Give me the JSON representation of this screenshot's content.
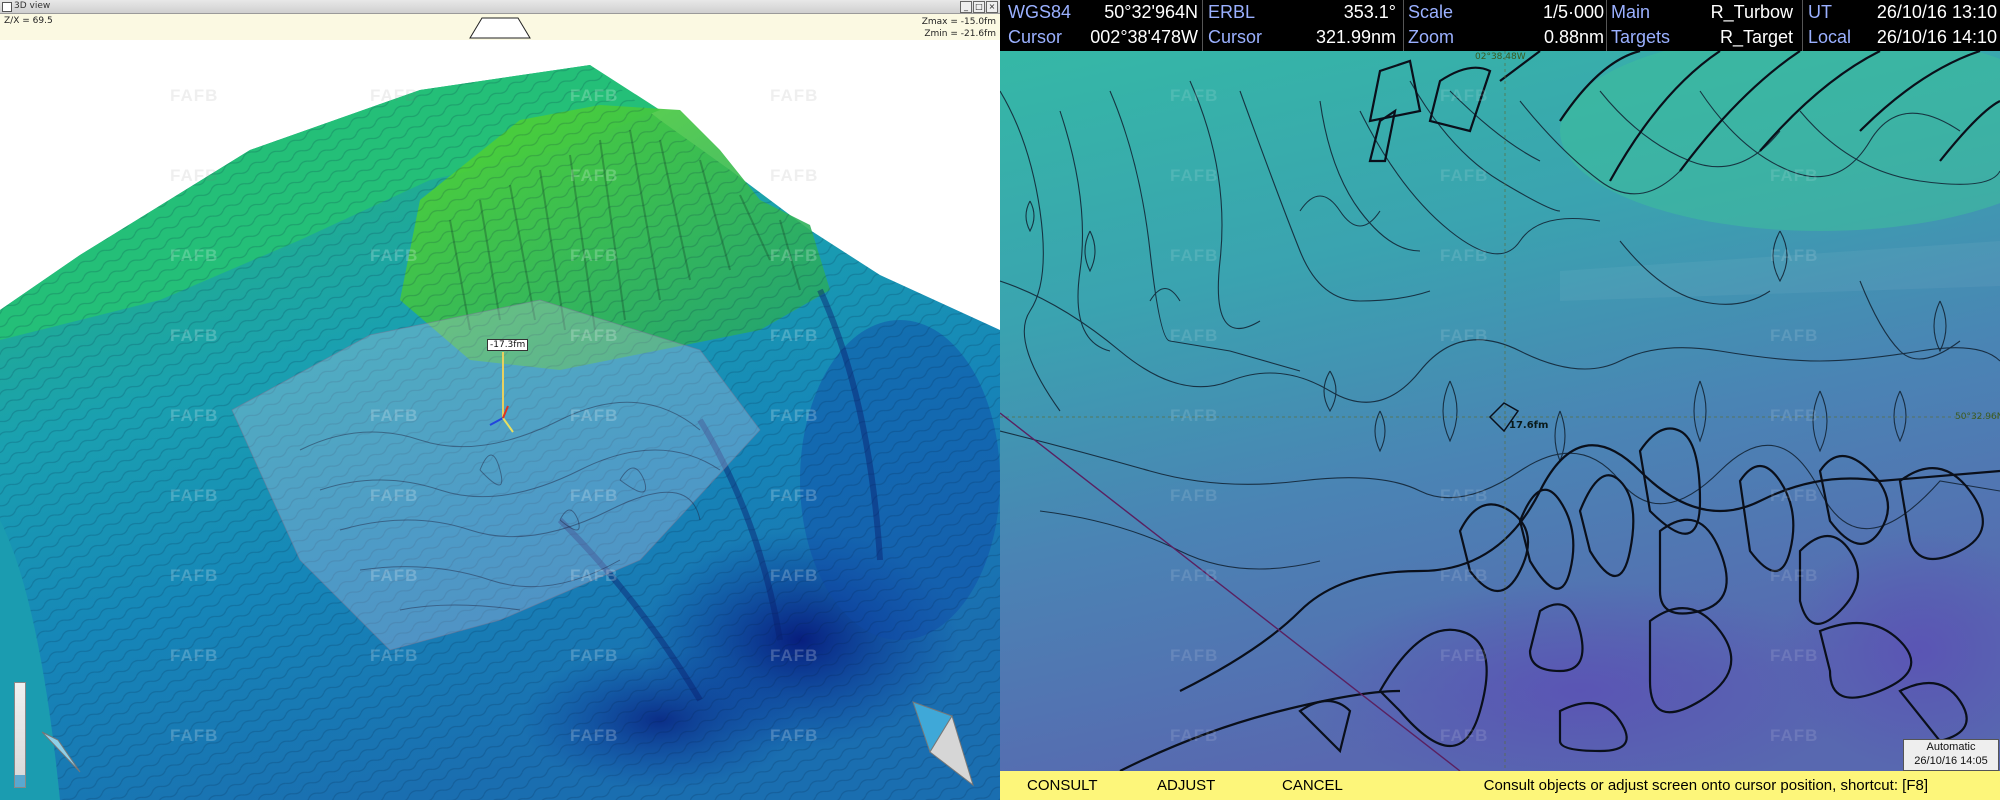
{
  "view3d": {
    "window_title": "3D view",
    "zx_label": "Z/X = 69.5",
    "zmax_label": "Zmax = -15.0fm",
    "zmin_label": "Zmin = -21.6fm",
    "depth_marker": "-17.3fm",
    "window_buttons": [
      "_",
      "□",
      "×"
    ],
    "watermark": "FAFB"
  },
  "status": {
    "row1": {
      "datum": "WGS84",
      "latitude": "50°32'964N",
      "erbl_label": "ERBL",
      "erbl_bearing": "353.1°",
      "scale_label": "Scale",
      "scale_value": "1/5·000",
      "main_label": "Main",
      "main_value": "R_Turbow",
      "ut_label": "UT",
      "ut_value": "26/10/16 13:10"
    },
    "row2": {
      "cursor_label": "Cursor",
      "longitude": "002°38'478W",
      "cursor2_label": "Cursor",
      "cursor_range": "321.99nm",
      "zoom_label": "Zoom",
      "zoom_value": "0.88nm",
      "targets_label": "Targets",
      "targets_value": "R_Target",
      "local_label": "Local",
      "local_value": "26/10/16 14:10"
    }
  },
  "chart": {
    "depth_label": "17.6fm",
    "lat_tick": "50°32.96N",
    "top_tick": "02°38.48W",
    "watermark": "FAFB",
    "mode_box": {
      "line1": "Automatic",
      "line2": "26/10/16 14:05"
    }
  },
  "commands": {
    "consult": "CONSULT",
    "adjust": "ADJUST",
    "cancel": "CANCEL",
    "hint": "Consult objects or adjust screen onto cursor position, shortcut: [F8]"
  },
  "colors": {
    "status_bg": "#000000",
    "status_label": "#9ab0ff",
    "command_bar": "#fdf67a",
    "shallow": "#2ec46a",
    "mid": "#1aa6b4",
    "deep": "#0d2e8c"
  }
}
